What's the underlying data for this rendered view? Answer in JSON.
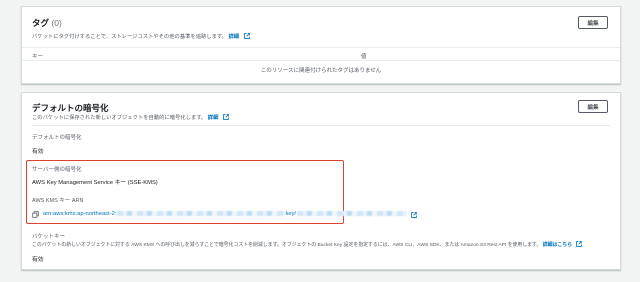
{
  "tags_panel": {
    "title": "タグ",
    "count": "(0)",
    "description": "バケットにタグ付けすることで、ストレージコストやその他の基準を追跡します。",
    "info_link": "詳細",
    "edit_button": "編集",
    "columns": {
      "key": "キー",
      "value": "値"
    },
    "empty_message": "このリソースに関連付けられたタグはありません"
  },
  "encryption_panel": {
    "title": "デフォルトの暗号化",
    "description": "このバケットに保存された新しいオブジェクトを自動的に暗号化します。",
    "info_link": "詳細",
    "edit_button": "編集",
    "default_encryption_label": "デフォルトの暗号化",
    "default_encryption_value": "有効",
    "server_side_label": "サーバー側の暗号化",
    "server_side_value": "AWS Key Management Service キー (SSE-KMS)",
    "kms_arn_label": "AWS KMS キー ARN",
    "kms_arn_value": "arn:aws:kms:ap-northeast-2:",
    "kms_arn_mid": "key/",
    "bucket_key_label": "バケットキー",
    "bucket_key_description": "このバケットの新しいオブジェクトに対する AWS KMS への呼び出しを減らすことで暗号化コストを削減します。オブジェクトの Bucket Key 設定を指定するには、AWS CLI、AWS SDK、または Amazon S3 Rest API を使用します。",
    "bucket_key_link": "詳細はこちら",
    "bucket_key_value": "有効"
  },
  "colors": {
    "link": "#0073bb",
    "highlight_border": "#e0412e",
    "background": "#f2f3f3"
  },
  "icons": [
    "external-link-icon",
    "copy-icon"
  ]
}
